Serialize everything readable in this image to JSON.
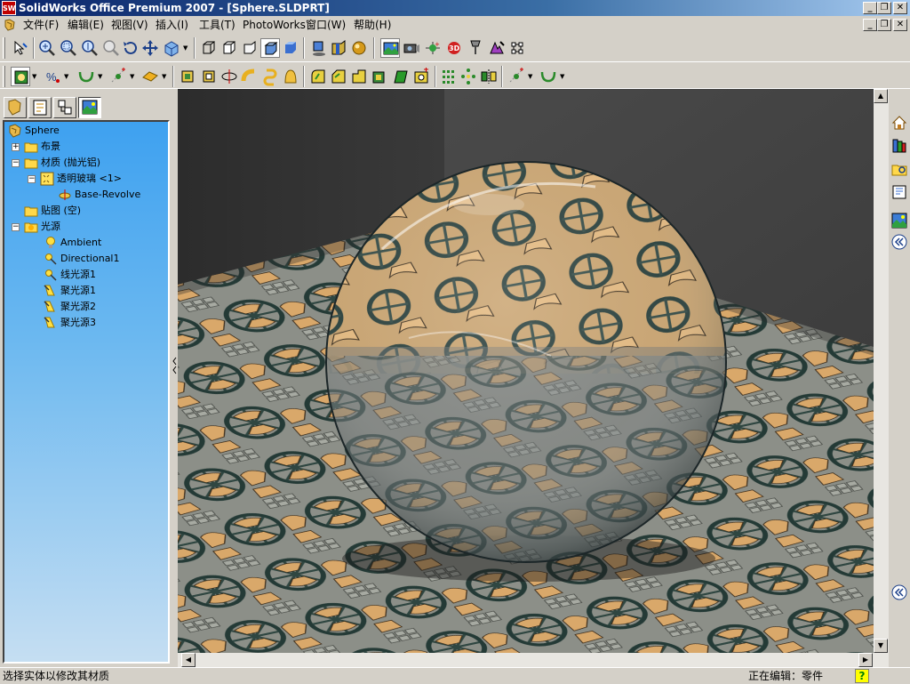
{
  "window": {
    "title": "SolidWorks Office Premium 2007 - [Sphere.SLDPRT]",
    "app_icon_text": "SW",
    "min_glyph": "_",
    "restore_glyph": "❐",
    "close_glyph": "✕"
  },
  "menu": {
    "items": [
      "文件(F)",
      "编辑(E)",
      "视图(V)",
      "插入(I)",
      "工具(T)",
      "PhotoWorks",
      "窗口(W)",
      "帮助(H)"
    ]
  },
  "tree": {
    "root": "Sphere",
    "items": [
      {
        "label": "布景",
        "expander": "+"
      },
      {
        "label": "材质 (抛光铝)",
        "expander": "−"
      },
      {
        "label": "透明玻璃 <1>",
        "expander": "−"
      },
      {
        "label": "Base-Revolve",
        "expander": ""
      },
      {
        "label": "贴图 (空)",
        "expander": ""
      },
      {
        "label": "光源",
        "expander": "−"
      },
      {
        "label": "Ambient",
        "expander": ""
      },
      {
        "label": "Directional1",
        "expander": ""
      },
      {
        "label": "线光源1",
        "expander": ""
      },
      {
        "label": "聚光源1",
        "expander": ""
      },
      {
        "label": "聚光源2",
        "expander": ""
      },
      {
        "label": "聚光源3",
        "expander": ""
      }
    ]
  },
  "status": {
    "message": "选择实体以修改其材质",
    "mode": "正在编辑：零件",
    "help_glyph": "?"
  },
  "colors": {
    "tree_top": "#3ea1f0",
    "floor_tan": "#d9a86a",
    "floor_stone": "#8c8f88",
    "background_wall": "#464646"
  }
}
